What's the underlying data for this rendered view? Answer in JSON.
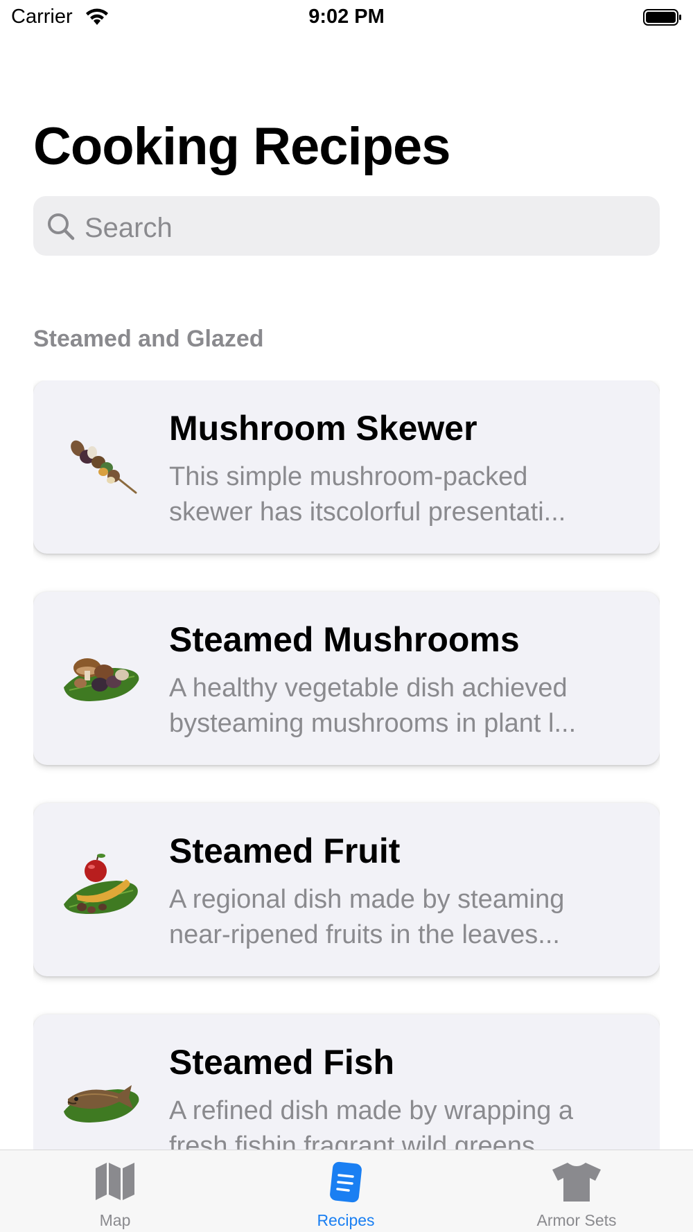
{
  "status_bar": {
    "carrier": "Carrier",
    "time": "9:02 PM"
  },
  "title": "Cooking Recipes",
  "search": {
    "placeholder": "Search"
  },
  "section": {
    "header": "Steamed and Glazed"
  },
  "recipes": [
    {
      "title": "Mushroom Skewer",
      "desc_line1": "This simple mushroom-packed",
      "desc_line2": "skewer has itscolorful presentati...",
      "icon": "mushroom-skewer-image"
    },
    {
      "title": "Steamed Mushrooms",
      "desc_line1": "A healthy vegetable dish achieved",
      "desc_line2": "bysteaming mushrooms in plant l...",
      "icon": "steamed-mushrooms-image"
    },
    {
      "title": "Steamed Fruit",
      "desc_line1": "A regional dish made by steaming",
      "desc_line2": "near-ripened fruits in the leaves...",
      "icon": "steamed-fruit-image"
    },
    {
      "title": "Steamed Fish",
      "desc_line1": "A refined dish made by wrapping a",
      "desc_line2": "fresh fishin fragrant wild greens...",
      "icon": "steamed-fish-image"
    }
  ],
  "tab_bar": {
    "tabs": [
      {
        "label": "Map",
        "icon": "map-icon",
        "active": false
      },
      {
        "label": "Recipes",
        "icon": "recipes-doc-icon",
        "active": true
      },
      {
        "label": "Armor Sets",
        "icon": "tshirt-icon",
        "active": false
      }
    ]
  },
  "colors": {
    "accent": "#1a7ff2",
    "secondary_text": "#8a8a8e",
    "card_bg": "#f2f2f7",
    "search_bg": "#eeeef0"
  }
}
